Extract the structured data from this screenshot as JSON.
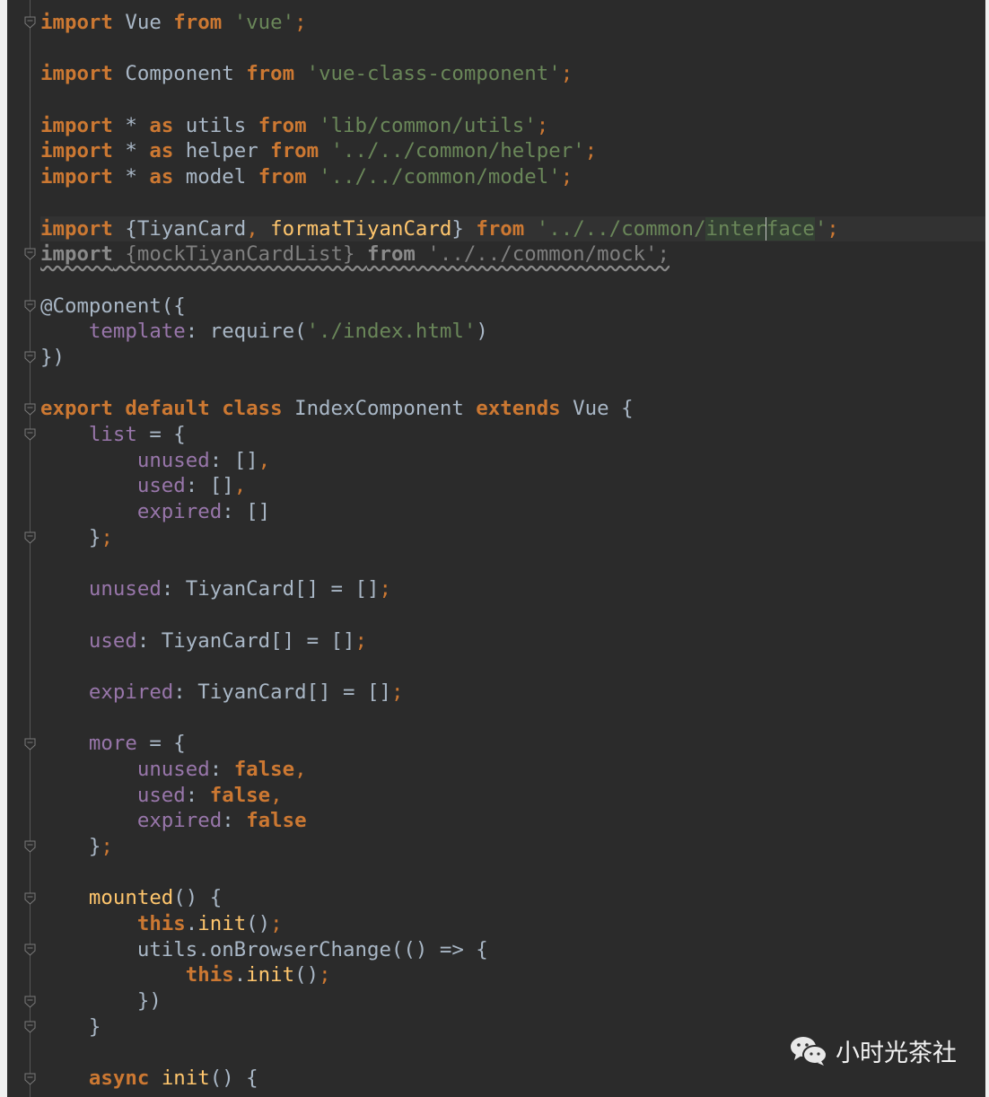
{
  "editor": {
    "colors": {
      "background": "#2b2b2b",
      "keyword": "#cc7832",
      "string": "#6a8759",
      "field": "#9876aa",
      "function": "#ffc66d",
      "text": "#a9b7c6"
    },
    "current_line": 8,
    "fold_markers": [
      0,
      9,
      11,
      13,
      15,
      16,
      20,
      28,
      32,
      34,
      36,
      38,
      39,
      41
    ],
    "lines": [
      [
        [
          "k",
          "import"
        ],
        [
          "t",
          " Vue "
        ],
        [
          "k",
          "from"
        ],
        [
          "t",
          " "
        ],
        [
          "s",
          "'vue'"
        ],
        [
          "o",
          ";"
        ]
      ],
      [],
      [
        [
          "k",
          "import"
        ],
        [
          "t",
          " Component "
        ],
        [
          "k",
          "from"
        ],
        [
          "t",
          " "
        ],
        [
          "s",
          "'vue-class-component'"
        ],
        [
          "o",
          ";"
        ]
      ],
      [],
      [
        [
          "k",
          "import"
        ],
        [
          "t",
          " * "
        ],
        [
          "k",
          "as"
        ],
        [
          "t",
          " utils "
        ],
        [
          "k",
          "from"
        ],
        [
          "t",
          " "
        ],
        [
          "s",
          "'lib/common/utils'"
        ],
        [
          "o",
          ";"
        ]
      ],
      [
        [
          "k",
          "import"
        ],
        [
          "t",
          " * "
        ],
        [
          "k",
          "as"
        ],
        [
          "t",
          " helper "
        ],
        [
          "k",
          "from"
        ],
        [
          "t",
          " "
        ],
        [
          "s",
          "'../../common/helper'"
        ],
        [
          "o",
          ";"
        ]
      ],
      [
        [
          "k",
          "import"
        ],
        [
          "t",
          " * "
        ],
        [
          "k",
          "as"
        ],
        [
          "t",
          " model "
        ],
        [
          "k",
          "from"
        ],
        [
          "t",
          " "
        ],
        [
          "s",
          "'../../common/model'"
        ],
        [
          "o",
          ";"
        ]
      ],
      [],
      [
        [
          "k",
          "import"
        ],
        [
          "t",
          " {TiyanCard"
        ],
        [
          "o",
          ","
        ],
        [
          "t",
          " "
        ],
        [
          "f",
          "formatTiyanCard"
        ],
        [
          "t",
          "} "
        ],
        [
          "k",
          "from"
        ],
        [
          "t",
          " "
        ],
        [
          "s",
          "'../../common/"
        ],
        [
          "s hl",
          "inter"
        ],
        [
          "caret",
          ""
        ],
        [
          "s hl",
          "face"
        ],
        [
          "s",
          "'"
        ],
        [
          "o",
          ";"
        ]
      ],
      [
        [
          "uk",
          "import"
        ],
        [
          "u",
          " {mockTiyanCardList} "
        ],
        [
          "uk",
          "from"
        ],
        [
          "u",
          " '../../common/mock';"
        ]
      ],
      [],
      [
        [
          "t",
          "@Component({"
        ]
      ],
      [
        [
          "t",
          "    "
        ],
        [
          "p",
          "template"
        ],
        [
          "t",
          ": require("
        ],
        [
          "s",
          "'./index.html'"
        ],
        [
          "t",
          ")"
        ]
      ],
      [
        [
          "t",
          "})"
        ]
      ],
      [],
      [
        [
          "k",
          "export default class"
        ],
        [
          "t",
          " IndexComponent "
        ],
        [
          "k",
          "extends"
        ],
        [
          "t",
          " Vue {"
        ]
      ],
      [
        [
          "t",
          "    "
        ],
        [
          "p",
          "list"
        ],
        [
          "t",
          " = {"
        ]
      ],
      [
        [
          "t",
          "        "
        ],
        [
          "p",
          "unused"
        ],
        [
          "t",
          ": []"
        ],
        [
          "o",
          ","
        ]
      ],
      [
        [
          "t",
          "        "
        ],
        [
          "p",
          "used"
        ],
        [
          "t",
          ": []"
        ],
        [
          "o",
          ","
        ]
      ],
      [
        [
          "t",
          "        "
        ],
        [
          "p",
          "expired"
        ],
        [
          "t",
          ": []"
        ]
      ],
      [
        [
          "t",
          "    }"
        ],
        [
          "o",
          ";"
        ]
      ],
      [],
      [
        [
          "t",
          "    "
        ],
        [
          "p",
          "unused"
        ],
        [
          "t",
          ": TiyanCard[] = []"
        ],
        [
          "o",
          ";"
        ]
      ],
      [],
      [
        [
          "t",
          "    "
        ],
        [
          "p",
          "used"
        ],
        [
          "t",
          ": TiyanCard[] = []"
        ],
        [
          "o",
          ";"
        ]
      ],
      [],
      [
        [
          "t",
          "    "
        ],
        [
          "p",
          "expired"
        ],
        [
          "t",
          ": TiyanCard[] = []"
        ],
        [
          "o",
          ";"
        ]
      ],
      [],
      [
        [
          "t",
          "    "
        ],
        [
          "p",
          "more"
        ],
        [
          "t",
          " = {"
        ]
      ],
      [
        [
          "t",
          "        "
        ],
        [
          "p",
          "unused"
        ],
        [
          "t",
          ": "
        ],
        [
          "k",
          "false"
        ],
        [
          "o",
          ","
        ]
      ],
      [
        [
          "t",
          "        "
        ],
        [
          "p",
          "used"
        ],
        [
          "t",
          ": "
        ],
        [
          "k",
          "false"
        ],
        [
          "o",
          ","
        ]
      ],
      [
        [
          "t",
          "        "
        ],
        [
          "p",
          "expired"
        ],
        [
          "t",
          ": "
        ],
        [
          "k",
          "false"
        ]
      ],
      [
        [
          "t",
          "    }"
        ],
        [
          "o",
          ";"
        ]
      ],
      [],
      [
        [
          "t",
          "    "
        ],
        [
          "f",
          "mounted"
        ],
        [
          "t",
          "() {"
        ]
      ],
      [
        [
          "t",
          "        "
        ],
        [
          "k",
          "this"
        ],
        [
          "t",
          "."
        ],
        [
          "f",
          "init"
        ],
        [
          "t",
          "()"
        ],
        [
          "o",
          ";"
        ]
      ],
      [
        [
          "t",
          "        utils.onBrowserChange(() => {"
        ]
      ],
      [
        [
          "t",
          "            "
        ],
        [
          "k",
          "this"
        ],
        [
          "t",
          "."
        ],
        [
          "f",
          "init"
        ],
        [
          "t",
          "()"
        ],
        [
          "o",
          ";"
        ]
      ],
      [
        [
          "t",
          "        })"
        ]
      ],
      [
        [
          "t",
          "    }"
        ]
      ],
      [],
      [
        [
          "t",
          "    "
        ],
        [
          "k",
          "async"
        ],
        [
          "t",
          " "
        ],
        [
          "f",
          "init"
        ],
        [
          "t",
          "() {"
        ]
      ]
    ]
  },
  "watermark": {
    "text": "小时光茶社",
    "icon": "wechat-icon"
  }
}
